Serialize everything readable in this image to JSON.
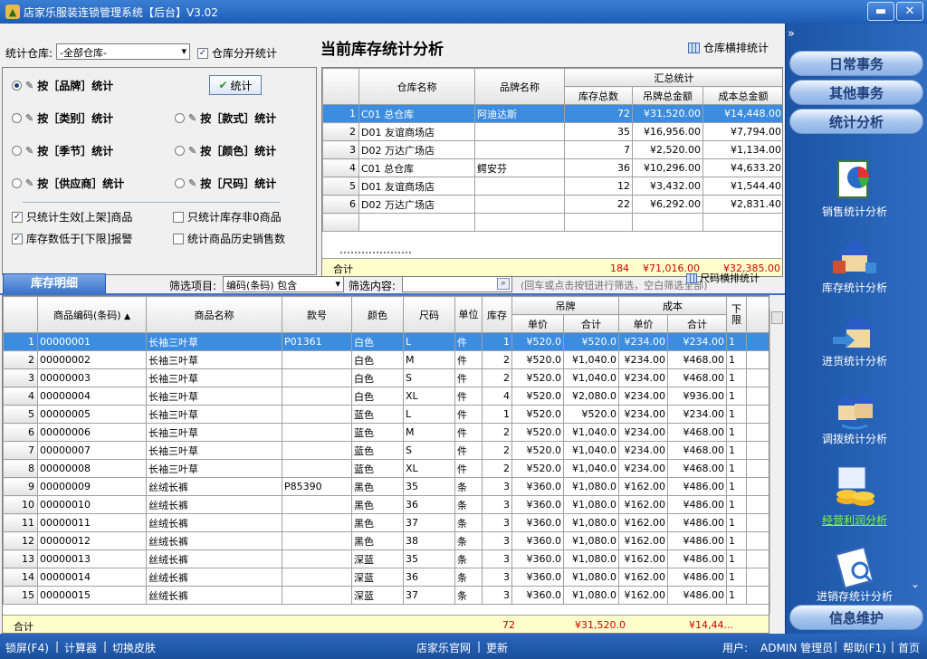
{
  "window": {
    "title": "店家乐服装连锁管理系统【后台】V3.02",
    "min": "▬",
    "close": "✕"
  },
  "filters": {
    "warehouse_label": "统计仓库:",
    "warehouse_value": "-全部仓库-",
    "split_label": "仓库分开统计",
    "page_title": "当前库存统计分析",
    "horiz_label": "仓库横排统计"
  },
  "options": {
    "by_brand": "按［品牌］统计",
    "by_category": "按［类别］统计",
    "by_style": "按［款式］统计",
    "by_season": "按［季节］统计",
    "by_color": "按［颜色］统计",
    "by_supplier": "按［供应商］统计",
    "by_size": "按［尺码］统计",
    "stat_button": "统计",
    "only_active": "只统计生效[上架]商品",
    "only_nonzero": "只统计库存非0商品",
    "below_limit": "库存数低于[下限]报警",
    "history_sales": "统计商品历史销售数"
  },
  "summary": {
    "headers": {
      "warehouse": "仓库名称",
      "brand": "品牌名称",
      "group": "汇总统计",
      "qty": "库存总数",
      "tag": "吊牌总金额",
      "cost": "成本总金额"
    },
    "rows": [
      {
        "n": "1",
        "wh": "C01 总仓库",
        "brand": "阿迪达斯",
        "qty": "72",
        "tag": "¥31,520.00",
        "cost": "¥14,448.00"
      },
      {
        "n": "2",
        "wh": "D01 友谊商场店",
        "brand": "",
        "qty": "35",
        "tag": "¥16,956.00",
        "cost": "¥7,794.00"
      },
      {
        "n": "3",
        "wh": "D02 万达广场店",
        "brand": "",
        "qty": "7",
        "tag": "¥2,520.00",
        "cost": "¥1,134.00"
      },
      {
        "n": "4",
        "wh": "C01 总仓库",
        "brand": "鳄安芬",
        "qty": "36",
        "tag": "¥10,296.00",
        "cost": "¥4,633.20"
      },
      {
        "n": "5",
        "wh": "D01 友谊商场店",
        "brand": "",
        "qty": "12",
        "tag": "¥3,432.00",
        "cost": "¥1,544.40"
      },
      {
        "n": "6",
        "wh": "D02 万达广场店",
        "brand": "",
        "qty": "22",
        "tag": "¥6,292.00",
        "cost": "¥2,831.40"
      }
    ],
    "total_label": "合计",
    "total_qty": "184",
    "total_tag": "¥71,016.00",
    "total_cost": "¥32,385.00"
  },
  "detail": {
    "tab": "库存明细",
    "filter_item_label": "筛选项目:",
    "filter_item_value": "编码(条码) 包含",
    "filter_content_label": "筛选内容:",
    "filter_hint": "(回车或点击按钮进行筛选，空白筛选全部)",
    "horiz_label": "尺码横排统计",
    "headers": {
      "code": "商品编码(条码)",
      "name": "商品名称",
      "style": "款号",
      "color": "颜色",
      "size": "尺码",
      "unit": "单位",
      "stock": "库存",
      "tag": "吊牌",
      "cost": "成本",
      "price": "单价",
      "sum": "合计",
      "low": "下限"
    },
    "rows": [
      {
        "n": "1",
        "code": "00000001",
        "name": "长袖三叶草",
        "style": "P01361",
        "color": "白色",
        "size": "L",
        "unit": "件",
        "qty": "1",
        "tp": "¥520.0",
        "ts": "¥520.0",
        "cp": "¥234.00",
        "cs": "¥234.00",
        "low": "1"
      },
      {
        "n": "2",
        "code": "00000002",
        "name": "长袖三叶草",
        "style": "",
        "color": "白色",
        "size": "M",
        "unit": "件",
        "qty": "2",
        "tp": "¥520.0",
        "ts": "¥1,040.0",
        "cp": "¥234.00",
        "cs": "¥468.00",
        "low": "1"
      },
      {
        "n": "3",
        "code": "00000003",
        "name": "长袖三叶草",
        "style": "",
        "color": "白色",
        "size": "S",
        "unit": "件",
        "qty": "2",
        "tp": "¥520.0",
        "ts": "¥1,040.0",
        "cp": "¥234.00",
        "cs": "¥468.00",
        "low": "1"
      },
      {
        "n": "4",
        "code": "00000004",
        "name": "长袖三叶草",
        "style": "",
        "color": "白色",
        "size": "XL",
        "unit": "件",
        "qty": "4",
        "tp": "¥520.0",
        "ts": "¥2,080.0",
        "cp": "¥234.00",
        "cs": "¥936.00",
        "low": "1"
      },
      {
        "n": "5",
        "code": "00000005",
        "name": "长袖三叶草",
        "style": "",
        "color": "蓝色",
        "size": "L",
        "unit": "件",
        "qty": "1",
        "tp": "¥520.0",
        "ts": "¥520.0",
        "cp": "¥234.00",
        "cs": "¥234.00",
        "low": "1"
      },
      {
        "n": "6",
        "code": "00000006",
        "name": "长袖三叶草",
        "style": "",
        "color": "蓝色",
        "size": "M",
        "unit": "件",
        "qty": "2",
        "tp": "¥520.0",
        "ts": "¥1,040.0",
        "cp": "¥234.00",
        "cs": "¥468.00",
        "low": "1"
      },
      {
        "n": "7",
        "code": "00000007",
        "name": "长袖三叶草",
        "style": "",
        "color": "蓝色",
        "size": "S",
        "unit": "件",
        "qty": "2",
        "tp": "¥520.0",
        "ts": "¥1,040.0",
        "cp": "¥234.00",
        "cs": "¥468.00",
        "low": "1"
      },
      {
        "n": "8",
        "code": "00000008",
        "name": "长袖三叶草",
        "style": "",
        "color": "蓝色",
        "size": "XL",
        "unit": "件",
        "qty": "2",
        "tp": "¥520.0",
        "ts": "¥1,040.0",
        "cp": "¥234.00",
        "cs": "¥468.00",
        "low": "1"
      },
      {
        "n": "9",
        "code": "00000009",
        "name": "丝绒长裤",
        "style": "P85390",
        "color": "黑色",
        "size": "35",
        "unit": "条",
        "qty": "3",
        "tp": "¥360.0",
        "ts": "¥1,080.0",
        "cp": "¥162.00",
        "cs": "¥486.00",
        "low": "1"
      },
      {
        "n": "10",
        "code": "00000010",
        "name": "丝绒长裤",
        "style": "",
        "color": "黑色",
        "size": "36",
        "unit": "条",
        "qty": "3",
        "tp": "¥360.0",
        "ts": "¥1,080.0",
        "cp": "¥162.00",
        "cs": "¥486.00",
        "low": "1"
      },
      {
        "n": "11",
        "code": "00000011",
        "name": "丝绒长裤",
        "style": "",
        "color": "黑色",
        "size": "37",
        "unit": "条",
        "qty": "3",
        "tp": "¥360.0",
        "ts": "¥1,080.0",
        "cp": "¥162.00",
        "cs": "¥486.00",
        "low": "1"
      },
      {
        "n": "12",
        "code": "00000012",
        "name": "丝绒长裤",
        "style": "",
        "color": "黑色",
        "size": "38",
        "unit": "条",
        "qty": "3",
        "tp": "¥360.0",
        "ts": "¥1,080.0",
        "cp": "¥162.00",
        "cs": "¥486.00",
        "low": "1"
      },
      {
        "n": "13",
        "code": "00000013",
        "name": "丝绒长裤",
        "style": "",
        "color": "深蓝",
        "size": "35",
        "unit": "条",
        "qty": "3",
        "tp": "¥360.0",
        "ts": "¥1,080.0",
        "cp": "¥162.00",
        "cs": "¥486.00",
        "low": "1"
      },
      {
        "n": "14",
        "code": "00000014",
        "name": "丝绒长裤",
        "style": "",
        "color": "深蓝",
        "size": "36",
        "unit": "条",
        "qty": "3",
        "tp": "¥360.0",
        "ts": "¥1,080.0",
        "cp": "¥162.00",
        "cs": "¥486.00",
        "low": "1"
      },
      {
        "n": "15",
        "code": "00000015",
        "name": "丝绒长裤",
        "style": "",
        "color": "深蓝",
        "size": "37",
        "unit": "条",
        "qty": "3",
        "tp": "¥360.0",
        "ts": "¥1,080.0",
        "cp": "¥162.00",
        "cs": "¥486.00",
        "low": "1"
      }
    ],
    "total_label": "合计",
    "total_qty": "72",
    "total_tag": "¥31,520.0",
    "total_cost": "¥14,44..."
  },
  "sidebar": {
    "expand": "»",
    "daily": "日常事务",
    "other": "其他事务",
    "analysis": "统计分析",
    "items": [
      "销售统计分析",
      "库存统计分析",
      "进货统计分析",
      "调拨统计分析",
      "经营利润分析",
      "进销存统计分析"
    ],
    "more": "⌄",
    "info": "信息维护"
  },
  "status": {
    "lock": "锁屏(F4)",
    "calc": "计算器",
    "skin": "切换皮肤",
    "site": "店家乐官网",
    "update": "更新",
    "user_label": "用户:",
    "user": "ADMIN 管理员",
    "help": "帮助(F1)",
    "home": "首页"
  }
}
